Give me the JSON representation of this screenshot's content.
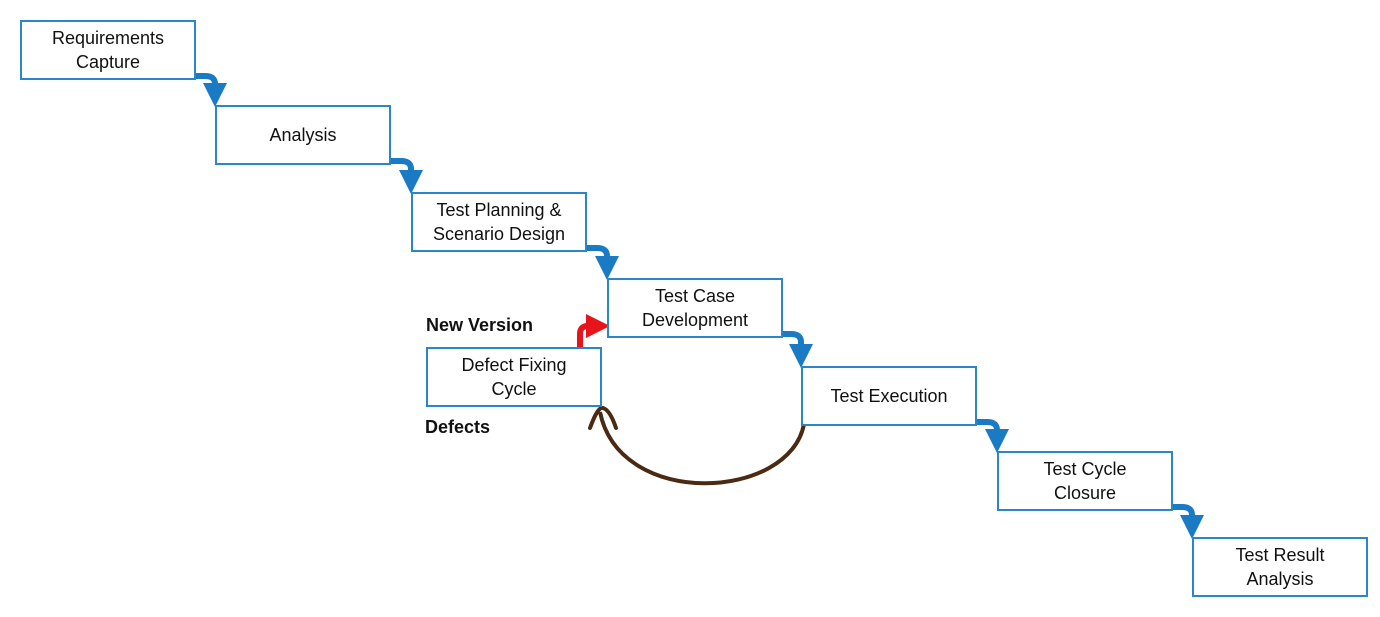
{
  "diagram": {
    "type": "waterfall-process",
    "steps": [
      {
        "id": "requirements",
        "label": "Requirements\nCapture"
      },
      {
        "id": "analysis",
        "label": "Analysis"
      },
      {
        "id": "test-planning",
        "label": "Test Planning &\nScenario Design"
      },
      {
        "id": "test-case-dev",
        "label": "Test Case\nDevelopment"
      },
      {
        "id": "test-execution",
        "label": "Test Execution"
      },
      {
        "id": "test-cycle-closure",
        "label": "Test Cycle\nClosure"
      },
      {
        "id": "test-result-analysis",
        "label": "Test Result\nAnalysis"
      }
    ],
    "loop": {
      "box": {
        "id": "defect-fixing",
        "label": "Defect Fixing\nCycle"
      },
      "new_version_label": "New Version",
      "defects_label": "Defects"
    },
    "colors": {
      "box_border": "#2a86c8",
      "flow_arrow": "#1a7bc4",
      "new_version_arrow": "#e8141b",
      "defects_arrow": "#4a2a12"
    }
  }
}
